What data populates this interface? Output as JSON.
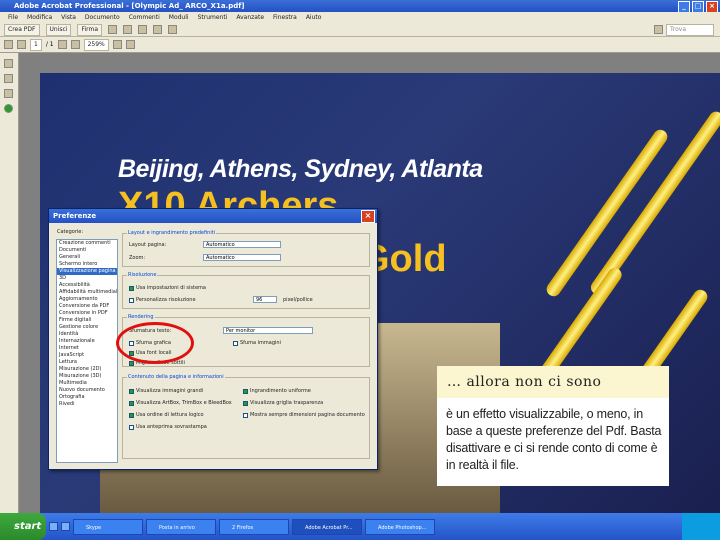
{
  "window": {
    "title": "Adobe Acrobat Professional - [Olympic Ad_ ARCO_X1a.pdf]"
  },
  "menu": [
    "File",
    "Modifica",
    "Vista",
    "Documento",
    "Commenti",
    "Moduli",
    "Strumenti",
    "Avanzate",
    "Finestra",
    "Aiuto"
  ],
  "toolbar": {
    "create_pdf": "Crea PDF",
    "combine": "Unisci",
    "sign": "Firma",
    "page_current": "1",
    "page_total": "/ 1",
    "zoom": "259%",
    "find_placeholder": "Trova"
  },
  "document": {
    "headline_cities": "Beijing, Athens, Sydney, Atlanta",
    "headline_archers": "X10 Archers",
    "headline_gold": "Gold"
  },
  "dialog": {
    "title": "Preferenze",
    "categories_label": "Categorie:",
    "categories": [
      "Creazione commenti",
      "Documenti",
      "Generali",
      "Schermo intero",
      "Visualizzazione pagina",
      "3D",
      "Accessibilità",
      "Affidabilità multimediale",
      "Aggiornamento",
      "Conversione da PDF",
      "Conversione in PDF",
      "Firme digitali",
      "Gestione colore",
      "Identità",
      "Internazionale",
      "Internet",
      "JavaScript",
      "Lettura",
      "Misurazione (2D)",
      "Misurazione (3D)",
      "Multimedia",
      "Nuovo documento",
      "Ortografia",
      "Rivedi"
    ],
    "selected_category_index": 4,
    "group_layout": "Layout e ingrandimento predefiniti",
    "layout_label": "Layout pagina:",
    "layout_value": "Automatico",
    "zoom_label": "Zoom:",
    "zoom_value": "Automatico",
    "group_resolution": "Risoluzione",
    "resolution_system": "Usa impostazioni di sistema",
    "resolution_custom": "Personalizza risoluzione",
    "resolution_value": "96",
    "resolution_unit": "pixel/pollice",
    "group_rendering": "Rendering",
    "rendering_label": "Sfumatura testo:",
    "rendering_value": "Per monitor",
    "smooth_art": "Sfuma grafica",
    "smooth_images": "Sfuma immagini",
    "use_local_fonts": "Usa font locali",
    "enhance_lines": "Migliora linee sottili",
    "group_content": "Contenuto della pagina e informazioni",
    "show_large_images": "Visualizza immagini grandi",
    "smooth_zoom": "Ingrandimento uniforme",
    "show_art_trim": "Visualizza ArtBox, TrimBox e BleedBox",
    "show_transparency": "Visualizza griglia trasparenza",
    "use_logical_order": "Usa ordine di lettura logico",
    "always_show_size": "Mostra sempre dimensioni pagina documento",
    "use_overprint": "Usa anteprima sovrastampa"
  },
  "note": {
    "heading": "… allora non ci sono",
    "body": "è un effetto visualizzabile, o meno, in base a queste preferenze del Pdf. Basta disattivare e ci si rende conto di come è in realtà il file."
  },
  "taskbar": {
    "start": "start",
    "tasks": [
      "Skype",
      "Posta in arrivo",
      "2 Firefox",
      "Adobe Acrobat Pr...",
      "Adobe Photoshop..."
    ],
    "active_task_index": 3
  }
}
